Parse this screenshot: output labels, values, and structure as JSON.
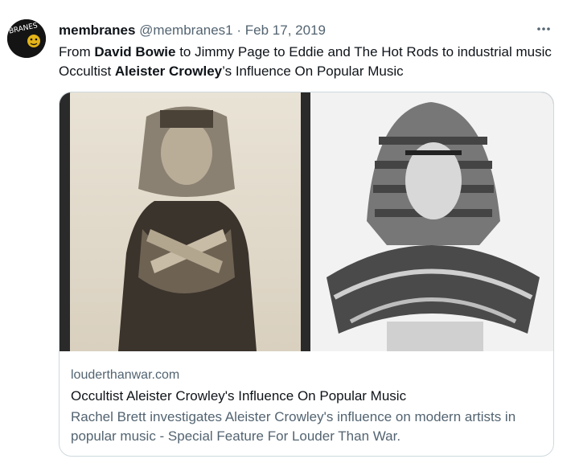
{
  "tweet": {
    "display_name": "membranes",
    "handle": "@membranes1",
    "separator": "·",
    "date": "Feb 17, 2019",
    "avatar_text": "BRANES",
    "more_icon": "more-horizontal-icon",
    "text_parts": [
      {
        "text": "From ",
        "bold": false
      },
      {
        "text": "David Bowie",
        "bold": true
      },
      {
        "text": " to Jimmy Page to Eddie and The Hot  Rods to industrial music Occultist ",
        "bold": false
      },
      {
        "text": "Aleister Crowley",
        "bold": true
      },
      {
        "text": "’s Influence On Popular Music",
        "bold": false
      }
    ]
  },
  "card": {
    "domain": "louderthanwar.com",
    "title": "Occultist Aleister Crowley's Influence On Popular Music",
    "description": "Rachel Brett investigates Aleister Crowley's influence on modern artists in popular music - Special Feature For Louder Than War."
  },
  "colors": {
    "text_primary": "#0f1419",
    "text_secondary": "#536471",
    "border": "#cfd9de"
  }
}
